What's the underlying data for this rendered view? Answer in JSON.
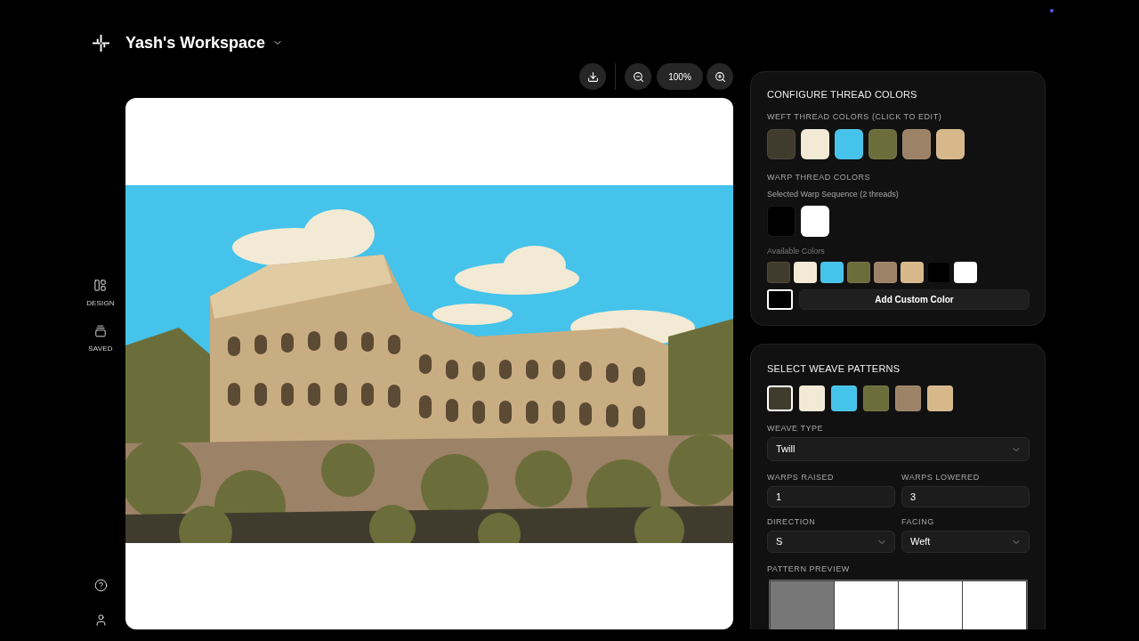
{
  "header": {
    "title": "Yash's Workspace"
  },
  "sidebar": {
    "items": [
      {
        "kind": "design",
        "label": "DESIGN"
      },
      {
        "kind": "saved",
        "label": "SAVED"
      }
    ]
  },
  "toolbar": {
    "zoom_level": "100%"
  },
  "thread_colors": {
    "title": "CONFIGURE THREAD COLORS",
    "weft_label": "WEFT THREAD COLORS (CLICK TO EDIT)",
    "weft_colors": [
      {
        "color": "#403c2d"
      },
      {
        "color": "#f2ead4"
      },
      {
        "color": "#45c3ea"
      },
      {
        "color": "#6b6e3a"
      },
      {
        "color": "#9c8266"
      },
      {
        "color": "#d6b88a"
      }
    ],
    "warp_label": "WARP THREAD COLORS",
    "warp_sequence_label": "Selected Warp Sequence (2 threads)",
    "warp_sequence": [
      {
        "color": "#000000"
      },
      {
        "color": "#ffffff"
      }
    ],
    "available_label": "Available Colors",
    "available_colors": [
      {
        "color": "#403c2d"
      },
      {
        "color": "#f2ead4"
      },
      {
        "color": "#45c3ea"
      },
      {
        "color": "#6b6e3a"
      },
      {
        "color": "#9c8266"
      },
      {
        "color": "#d6b88a"
      },
      {
        "color": "#000000"
      },
      {
        "color": "#ffffff"
      }
    ],
    "custom_color": {
      "color": "#000000"
    },
    "add_button": "Add Custom Color"
  },
  "weave_patterns": {
    "title": "SELECT WEAVE PATTERNS",
    "swatches": [
      {
        "color": "#403c2d",
        "selected": true
      },
      {
        "color": "#f2ead4",
        "selected": false
      },
      {
        "color": "#45c3ea",
        "selected": false
      },
      {
        "color": "#6b6e3a",
        "selected": false
      },
      {
        "color": "#9c8266",
        "selected": false
      },
      {
        "color": "#d6b88a",
        "selected": false
      }
    ],
    "weave_type": {
      "label": "WEAVE TYPE",
      "value": "Twill"
    },
    "warps_raised": {
      "label": "WARPS RAISED",
      "value": "1"
    },
    "warps_lowered": {
      "label": "WARPS LOWERED",
      "value": "3"
    },
    "direction": {
      "label": "DIRECTION",
      "value": "S"
    },
    "facing": {
      "label": "FACING",
      "value": "Weft"
    },
    "preview": {
      "label": "PATTERN PREVIEW",
      "cells": [
        {
          "raised": true
        },
        {
          "raised": false
        },
        {
          "raised": false
        },
        {
          "raised": false
        }
      ]
    }
  }
}
